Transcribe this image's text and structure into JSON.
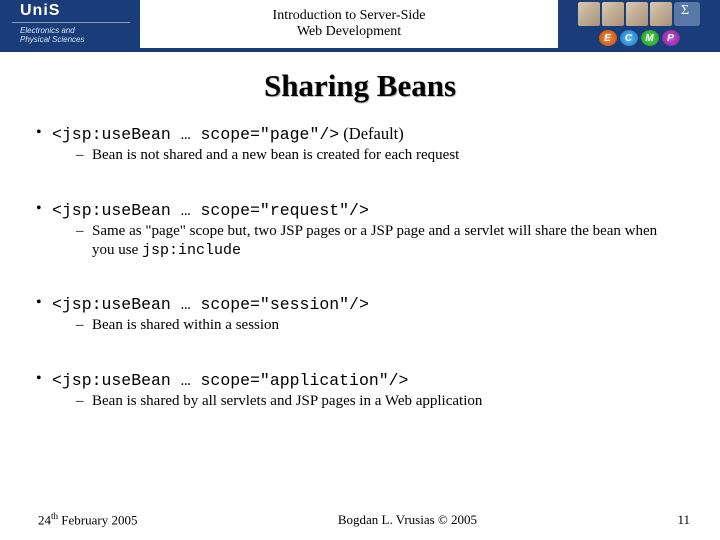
{
  "header": {
    "logo": "UniS",
    "dept_line1": "Electronics and",
    "dept_line2": "Physical Sciences",
    "course_line1": "Introduction to Server-Side",
    "course_line2": "Web Development",
    "chips": {
      "e": "E",
      "c": "C",
      "m": "M",
      "p": "P"
    }
  },
  "title": "Sharing Beans",
  "bullets": [
    {
      "code": "<jsp:useBean … scope=\"page\"/>",
      "suffix": " (Default)",
      "sub_text": "Bean is not shared and a new bean is created for each request",
      "sub_code": ""
    },
    {
      "code": "<jsp:useBean … scope=\"request\"/>",
      "suffix": "",
      "sub_text": "Same as \"page\" scope but, two JSP pages or a JSP page and a servlet  will share the bean when you use ",
      "sub_code": "jsp:include"
    },
    {
      "code": "<jsp:useBean … scope=\"session\"/>",
      "suffix": "",
      "sub_text": "Bean is shared within a session",
      "sub_code": ""
    },
    {
      "code": "<jsp:useBean … scope=\"application\"/>",
      "suffix": "",
      "sub_text": "Bean is shared by all servlets and JSP pages in a Web application",
      "sub_code": ""
    }
  ],
  "footer": {
    "date_day": "24",
    "date_th": "th",
    "date_rest": " February 2005",
    "author": "Bogdan L. Vrusias © 2005",
    "page": "11"
  }
}
